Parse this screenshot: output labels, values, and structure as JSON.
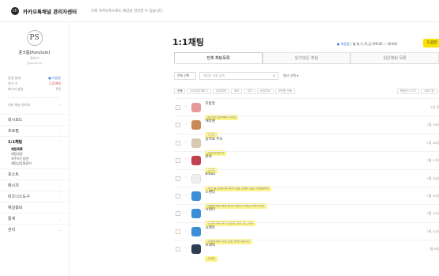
{
  "header": {
    "logo_mark": "ch",
    "logo_text": "카카오톡채널 관리자센터",
    "note": "이제 카카오톡으로도 채널을 관리할 수 있습니다."
  },
  "profile": {
    "avatar_text": "PS",
    "name": "푼크툼(Punctum)",
    "sub": "관리자",
    "mini": "@punctum"
  },
  "stats": [
    {
      "label": "운영 상태",
      "value": "● 이용중",
      "color": "blue"
    },
    {
      "label": "친구 수",
      "value": "1,209명",
      "color": "red"
    },
    {
      "label": "메시지 발송",
      "value": "0건",
      "color": "gray"
    }
  ],
  "plan": {
    "label": "기본 채널 관리자",
    "value": "›"
  },
  "menu": [
    {
      "label": "대시보드",
      "chev": "",
      "active": false
    },
    {
      "label": "프로필",
      "chev": "⌄",
      "active": false
    },
    {
      "label": "1:1채팅",
      "chev": "⌃",
      "active": true,
      "sub": [
        "채팅목록",
        "채팅설정",
        "자주쓰는답변",
        "채팅상담원관리"
      ]
    },
    {
      "label": "포스트",
      "chev": "",
      "active": false
    },
    {
      "label": "메시지",
      "chev": "⌄",
      "active": false
    },
    {
      "label": "비즈니스도구",
      "chev": "⌄",
      "active": false
    },
    {
      "label": "채널홍보",
      "chev": "",
      "active": false
    },
    {
      "label": "통계",
      "chev": "⌄",
      "active": false
    },
    {
      "label": "관리",
      "chev": "⌄",
      "active": false
    }
  ],
  "main": {
    "title": "1:1채팅",
    "status_dot": "●",
    "status_on": "채팅중",
    "status_text": "| 월,화,수,목,금 (09:00 ~ 18:00)",
    "help_label": "도움말"
  },
  "tabs": [
    {
      "label": "전체 채팅목록",
      "active": true
    },
    {
      "label": "읽지않은 채팅",
      "active": false
    },
    {
      "label": "읽은채팅 목록",
      "active": false
    }
  ],
  "filters": {
    "select": "전체 선택",
    "search_placeholder": "채팅방 이름 검색",
    "filter_label": "필터 선택 ▾"
  },
  "toolbar": {
    "left": [
      "전체",
      "읽지않은채팅 1",
      "읽은채팅",
      "중요",
      "대기",
      "상담완료",
      "보관함 이동"
    ],
    "right": [
      "채팅방 나가기",
      "새로고침"
    ]
  },
  "chats": [
    {
      "name": "조방장",
      "msg": "네 사진 감사해요 (사진)",
      "date": "2일 전",
      "color": "#e59a9a"
    },
    {
      "name": "대작원",
      "msg": "(사진)",
      "date": "7월 19일",
      "color": "#c98a5a"
    },
    {
      "name": "승지효 주도",
      "msg": "네 감사합니다",
      "date": "7월 18일",
      "color": "#d8c9b0"
    },
    {
      "name": "준희",
      "msg": "(사진)",
      "date": "7월 17일",
      "color": "#c04050"
    },
    {
      "name": "bihoo",
      "msg": "사진 잘 받았어요 혹시 주말 전에도 상담 가능할까요",
      "date": "7월 16일",
      "color": "#f0f0f0"
    },
    {
      "name": "스켄더",
      "msg": "안녕하세요 상담 문의 드립니다 확인 부탁드려요",
      "date": "7월 15일",
      "color": "#3a8fd8"
    },
    {
      "name": "시켄더",
      "msg": "안녕하세요 제가 궁금한 점이 있는데요",
      "date": "7월 12일",
      "color": "#3a8fd8"
    },
    {
      "name": "시켄즈",
      "msg": "안녕하세요 주문 관련 문의드립니다",
      "date": "7월 10일",
      "color": "#3a8fd8"
    },
    {
      "name": "오데릭",
      "msg": "(사진)",
      "date": "7월 9일",
      "color": "#2e3d52"
    }
  ]
}
